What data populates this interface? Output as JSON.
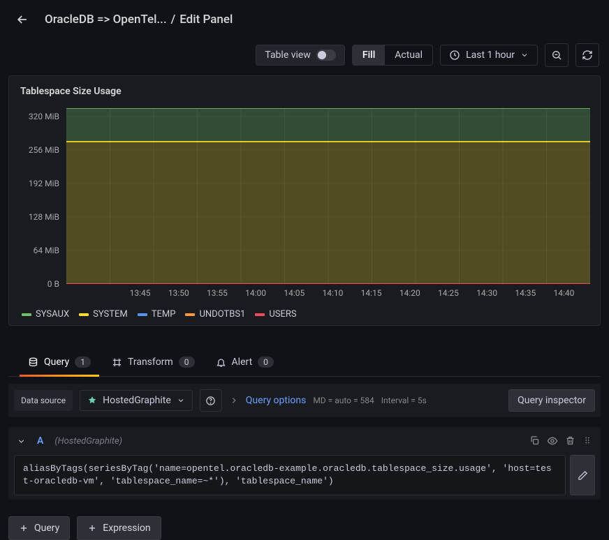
{
  "header": {
    "title": "OracleDB => OpenTel...",
    "sep": "/",
    "edit": "Edit Panel"
  },
  "toolbar": {
    "table_view": "Table view",
    "fill": "Fill",
    "actual": "Actual",
    "time_range": "Last 1 hour"
  },
  "panel": {
    "title": "Tablespace Size Usage"
  },
  "chart_data": {
    "type": "line",
    "x": [
      "13:45",
      "13:50",
      "13:55",
      "14:00",
      "14:05",
      "14:10",
      "14:15",
      "14:20",
      "14:25",
      "14:30",
      "14:35",
      "14:40"
    ],
    "series": [
      {
        "name": "SYSAUX",
        "color": "#73bf69",
        "value_mib": 336
      },
      {
        "name": "SYSTEM",
        "color": "#fade2a",
        "value_mib": 272
      },
      {
        "name": "TEMP",
        "color": "#5794f2",
        "value_mib": 0
      },
      {
        "name": "UNDOTBS1",
        "color": "#ff9830",
        "value_mib": 0
      },
      {
        "name": "USERS",
        "color": "#f2495c",
        "value_mib": 0
      }
    ],
    "ylabels": [
      "320 MiB",
      "256 MiB",
      "192 MiB",
      "128 MiB",
      "64 MiB",
      "0 B"
    ],
    "ylim": [
      0,
      336
    ]
  },
  "tabs": {
    "query": {
      "label": "Query",
      "count": "1"
    },
    "transform": {
      "label": "Transform",
      "count": "0"
    },
    "alert": {
      "label": "Alert",
      "count": "0"
    }
  },
  "qbar": {
    "label": "Data source",
    "datasource": "HostedGraphite",
    "query_options": "Query options",
    "md": "MD = auto = 584",
    "interval": "Interval = 5s",
    "inspector": "Query inspector"
  },
  "qrow": {
    "letter": "A",
    "hint": "(HostedGraphite)",
    "query": "aliasByTags(seriesByTag('name=opentel.oracledb-example.oracledb.tablespace_size.usage', 'host=test-oracledb-vm', 'tablespace_name=~*'), 'tablespace_name')"
  },
  "actions": {
    "add_query": "Query",
    "add_expr": "Expression"
  }
}
